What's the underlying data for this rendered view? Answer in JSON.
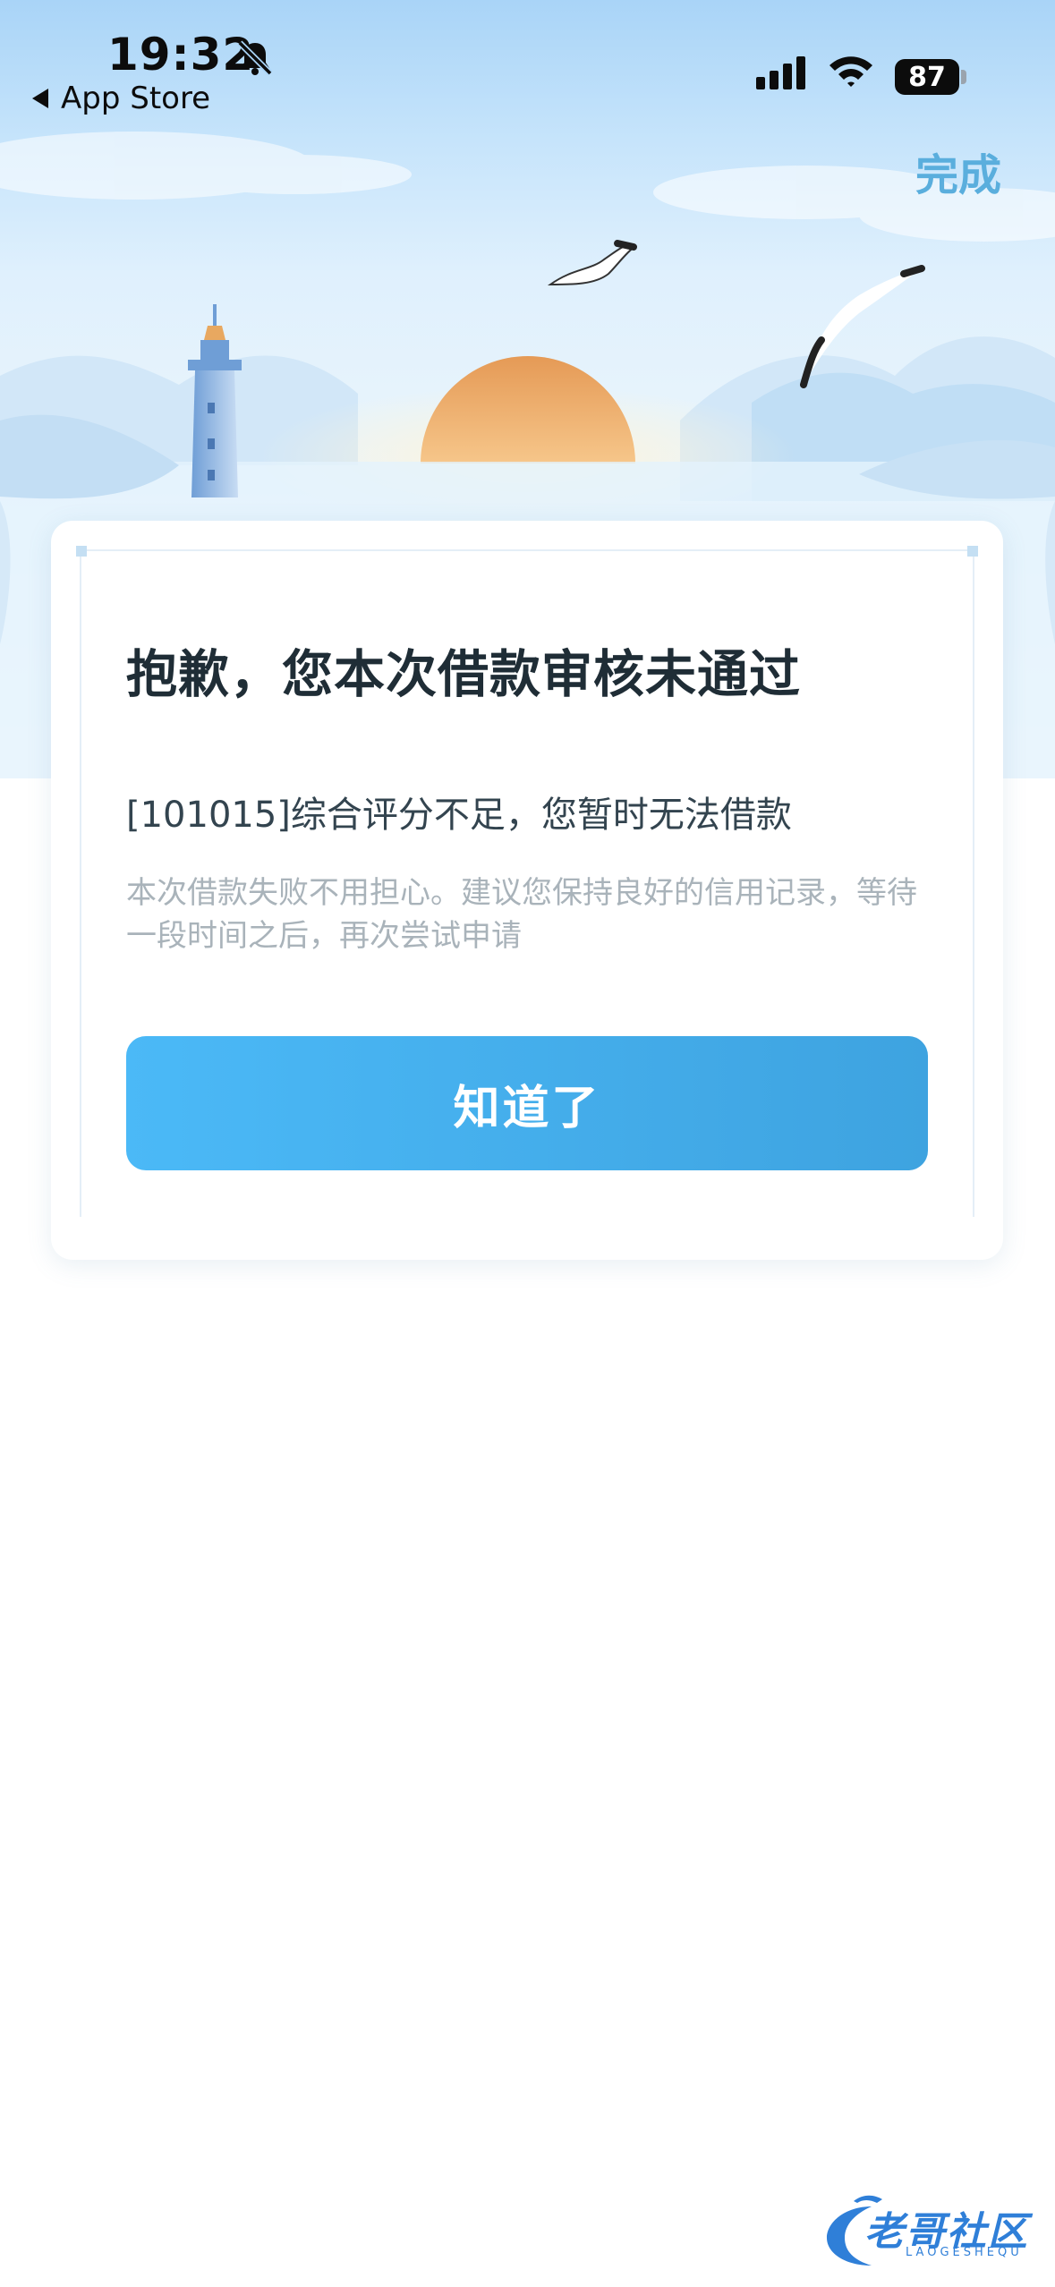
{
  "status_bar": {
    "time": "19:32",
    "back_label": "App Store",
    "battery": "87",
    "icons": [
      "bell-off-icon",
      "signal-icon",
      "wifi-icon",
      "battery-icon"
    ]
  },
  "header": {
    "done_label": "完成"
  },
  "card": {
    "title": "抱歉，您本次借款审核未通过",
    "reason": "[101015]综合评分不足，您暂时无法借款",
    "hint": "本次借款失败不用担心。建议您保持良好的信用记录，等待一段时间之后，再次尝试申请",
    "ok_label": "知道了"
  },
  "watermark": {
    "text": "老哥社区",
    "sub": "LAOGESHEQU"
  },
  "colors": {
    "accent": "#5aaedd",
    "button_start": "#4bb9f7",
    "button_end": "#3ea3e0",
    "title": "#1f2d36",
    "hint": "#a9b3ba"
  }
}
